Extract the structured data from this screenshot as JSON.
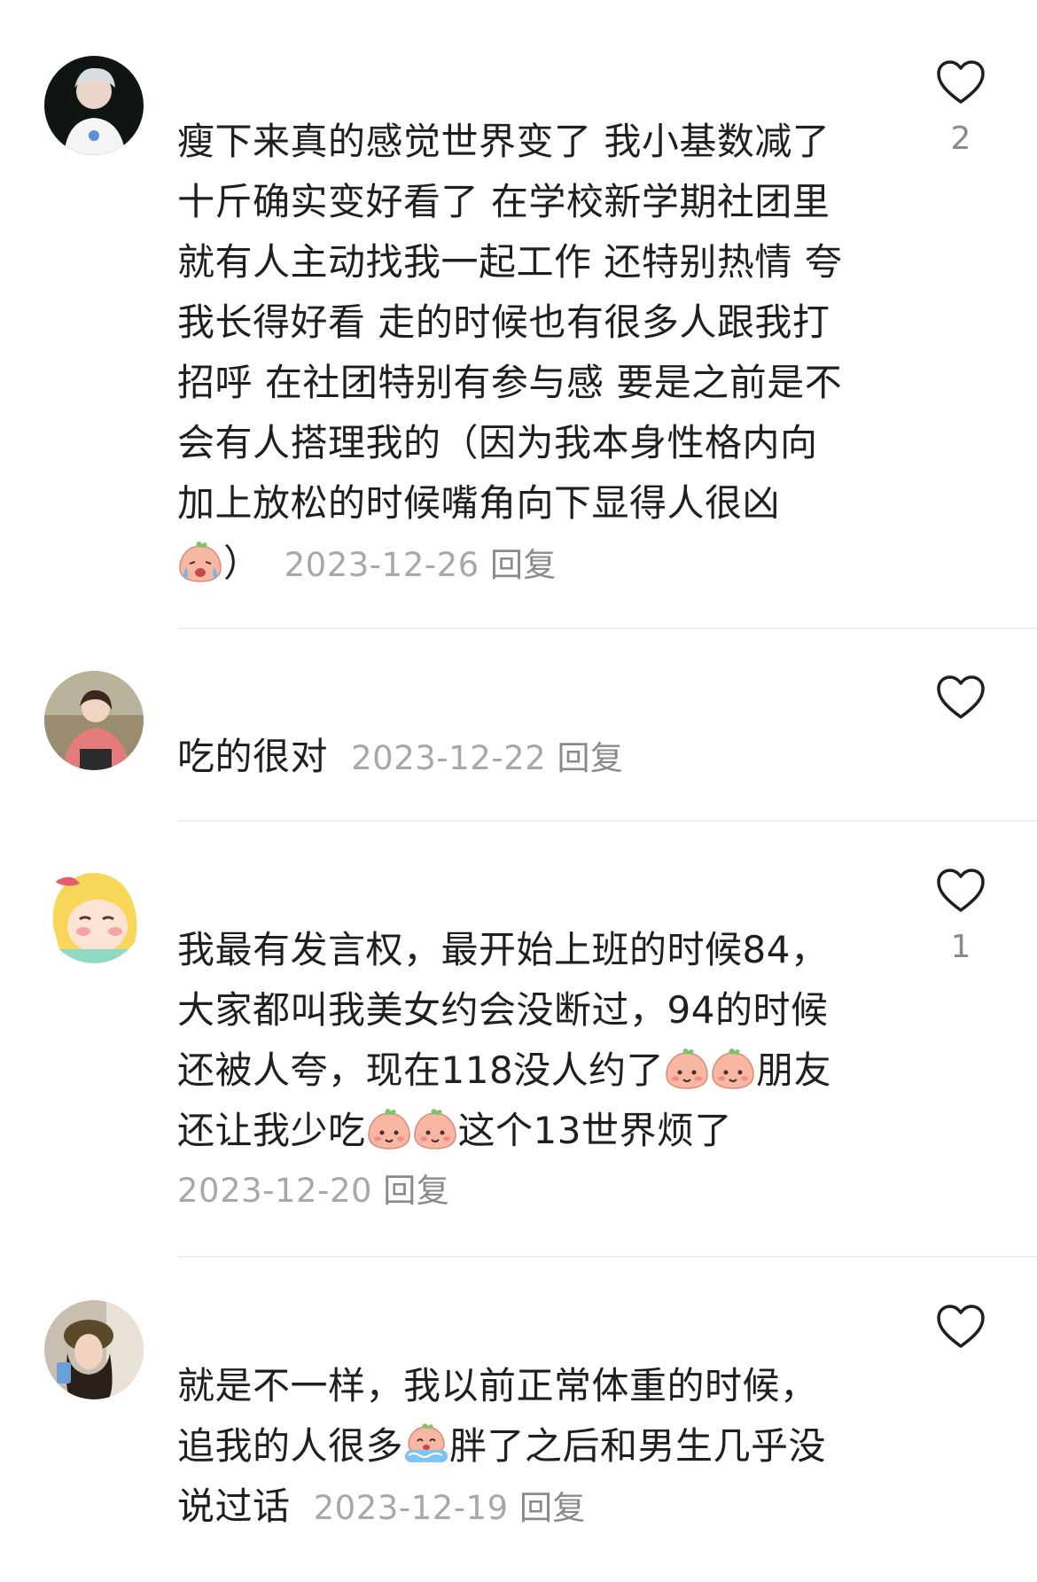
{
  "comments": [
    {
      "text_lines": [
        "瘦下来真的感觉世界变了 我小基数减了",
        "十斤确实变好看了 在学校新学期社团里",
        "就有人主动找我一起工作 还特别热情 夸",
        "我长得好看 走的时候也有很多人跟我打",
        "招呼 在社团特别有参与感 要是之前是不",
        "会有人搭理我的（因为我本身性格内向",
        "加上放松的时候嘴角向下显得人很凶"
      ],
      "tail_text": "）",
      "date": "2023-12-26",
      "reply_label": "回复",
      "likes": "2",
      "emojis": [
        "crying-face-emoji"
      ]
    },
    {
      "text": "吃的很对",
      "date": "2023-12-22",
      "reply_label": "回复",
      "likes": ""
    },
    {
      "line1": "我最有发言权，最开始上班的时候84，",
      "line2": "大家都叫我美女约会没断过，94的时候",
      "line3a": "还被人夸，现在118没人约了",
      "line3b": "朋友",
      "line4a": "还让我少吃",
      "line4b": "这个13世界烦了",
      "date": "2023-12-20",
      "reply_label": "回复",
      "likes": "1",
      "emojis": [
        "peach-smile-emoji"
      ]
    },
    {
      "line1": "就是不一样，我以前正常体重的时候，",
      "line2a": "追我的人很多",
      "line2b": "胖了之后和男生几乎没",
      "line3": "说过话",
      "date": "2023-12-19",
      "reply_label": "回复",
      "likes": "",
      "emojis": [
        "crying-bath-emoji"
      ]
    }
  ]
}
